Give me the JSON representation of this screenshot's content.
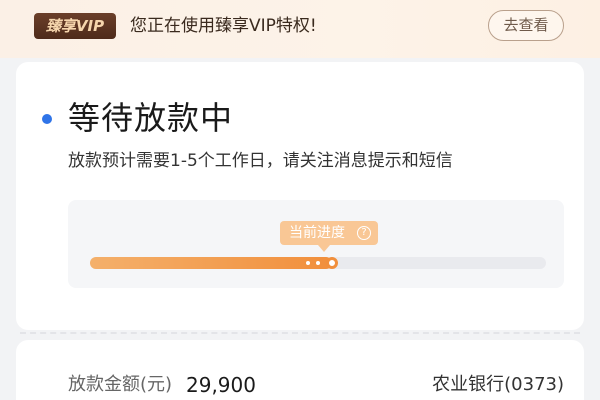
{
  "vip": {
    "badge": "臻享VIP",
    "message": "您正在使用臻享VIP特权!",
    "button": "去查看"
  },
  "status": {
    "title": "等待放款中",
    "description": "放款预计需要1-5个工作日，请关注消息提示和短信",
    "accent_color": "#2f74e8"
  },
  "progress": {
    "tip_label": "当前进度",
    "tip_icon": "question-circle-icon",
    "fraction": 0.53,
    "fill_color": "#f18f3c"
  },
  "loan": {
    "amount_label": "放款金额(元)",
    "amount_value": "29,900",
    "bank": "农业银行(0373)"
  }
}
